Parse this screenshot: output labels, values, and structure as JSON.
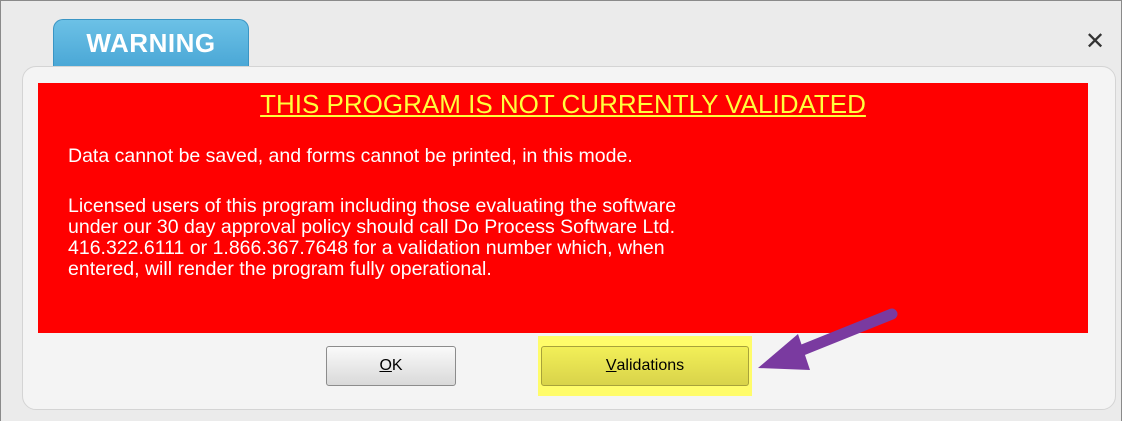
{
  "dialog": {
    "tab_title": "WARNING",
    "close_glyph": "✕",
    "alert": {
      "title": "THIS PROGRAM IS NOT CURRENTLY VALIDATED",
      "line1": "Data cannot be saved, and forms cannot be printed, in this mode.",
      "paragraph2": [
        "Licensed users of this program including those evaluating the software",
        "under our 30 day approval policy should call Do Process Software Ltd.",
        "416.322.6111 or 1.866.367.7648 for a validation number which, when",
        "entered, will render the program fully operational."
      ]
    },
    "buttons": {
      "ok": {
        "mnemonic": "O",
        "rest": "K"
      },
      "validations": {
        "mnemonic": "V",
        "rest": "alidations"
      }
    }
  },
  "colors": {
    "alert_background": "#ff0000",
    "alert_title": "#ffff3c",
    "tab_background": "#4aa7d6",
    "validations_highlight": "#fffc6a",
    "arrow": "#7a3aa0"
  },
  "icons": {
    "close": "close-icon",
    "annotation": "arrow-icon"
  }
}
